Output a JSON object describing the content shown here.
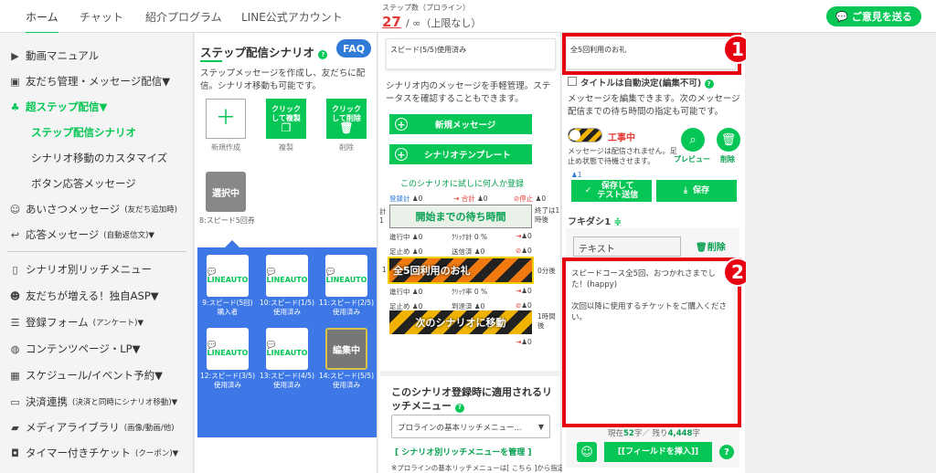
{
  "top_nav": {
    "tabs": [
      "ホーム",
      "チャット",
      "紹介プログラム",
      "LINE公式アカウント"
    ],
    "step_label": "ステップ数（プロライン）",
    "step_value": "27",
    "step_rest": "/ ∞（上限なし）",
    "feedback": "ご意見を送る"
  },
  "sidebar": {
    "items": [
      {
        "icon": "video-icon",
        "label": "動画マニュアル"
      },
      {
        "icon": "contacts-icon",
        "label": "友だち管理・メッセージ配信▼"
      },
      {
        "icon": "step-icon",
        "label": "超ステップ配信▼"
      },
      {
        "icon": "chat-icon",
        "label": "あいさつメッセージ",
        "small": "(友だち追加時)"
      },
      {
        "icon": "reply-icon",
        "label": "応答メッセージ",
        "small": "(自動返信文)▼"
      },
      {
        "icon": "phone-icon",
        "label": "シナリオ別リッチメニュー"
      },
      {
        "icon": "friends-icon",
        "label": "友だちが増える！独自ASP▼"
      },
      {
        "icon": "list-icon",
        "label": "登録フォーム",
        "small": "(アンケート)▼"
      },
      {
        "icon": "globe-icon",
        "label": "コンテンツページ・LP▼"
      },
      {
        "icon": "calendar-icon",
        "label": "スケジュール/イベント予約▼"
      },
      {
        "icon": "card-icon",
        "label": "決済連携",
        "small": "(決済と同時にシナリオ移動)▼"
      },
      {
        "icon": "folder-icon",
        "label": "メディアライブラリ",
        "small": "(画像/動画/他)"
      },
      {
        "icon": "ticket-icon",
        "label": "タイマー付きチケット",
        "small": "(クーポン)▼"
      }
    ],
    "sub_items": [
      "ステップ配信シナリオ",
      "シナリオ移動のカスタマイズ",
      "ボタン応答メッセージ"
    ]
  },
  "scenario_panel": {
    "title": "ステップ配信シナリオ",
    "faq": "FAQ",
    "description": "ステップメッセージを作成し、友だちに配信。シナリオ移動も可能です。",
    "tools": [
      {
        "label": "",
        "caption": "新規作成"
      },
      {
        "label": "クリック\nして複製",
        "caption": "複製"
      },
      {
        "label": "クリック\nして削除",
        "caption": "削除"
      }
    ],
    "selected_card": "選択中",
    "selected_caption": "8:スピード5回券",
    "cards": [
      {
        "caption": "9:スピード(5回)購入者"
      },
      {
        "caption": "10:スピード(1/5)使用済み"
      },
      {
        "caption": "11:スピード(2/5)使用済み"
      },
      {
        "caption": "12:スピード(3/5)使用済み"
      },
      {
        "caption": "13:スピード(4/5)使用済み"
      },
      {
        "caption": "14:スピード(5/5)使用済み",
        "overlay": "編集中"
      }
    ],
    "card_logo": "LINEAUTO"
  },
  "flow_panel": {
    "header": "スピード(5/5)使用済み",
    "description": "シナリオ内のメッセージを手軽管理。ステータスを確認することもできます。",
    "new_message": "新規メッセージ",
    "template": "シナリオテンプレート",
    "test_link": "このシナリオに試しに何人か登録",
    "stats_top": {
      "registered": "登録計",
      "r_val": "0",
      "total": "合計",
      "t_val": "0",
      "stop": "停止",
      "s_val": "0"
    },
    "start_label_left": "計1",
    "end_label": "終了は1時後",
    "wait_bar": "開始までの待ち時間",
    "row1": {
      "progress": "進行中",
      "p": "0",
      "click_total": "ｸﾘｯｸ計",
      "c": "0 %",
      "v": "0"
    },
    "row2": {
      "stop": "足止め",
      "s": "0",
      "sent": "送信済",
      "sv": "0",
      "v": "0"
    },
    "msg_bar": "全5回利用のお礼",
    "msg_prefix": "1",
    "msg_after": "0分後",
    "row3": {
      "progress": "進行中",
      "p": "0",
      "click_rate": "ｸﾘｯｸ率",
      "c": "0 %",
      "v": "0"
    },
    "row4": {
      "stop": "足止め",
      "s": "0",
      "arrive": "到達済",
      "a": "0",
      "v": "0"
    },
    "move_bar": "次のシナリオに移動",
    "move_after": "1時間後",
    "move_stat": "0",
    "rich": {
      "title": "このシナリオ登録時に適用されるリッチメニュー",
      "select": "プロラインの基本リッチメニュー...",
      "manage": "[ シナリオ別リッチメニューを管理 ]",
      "note": "※プロラインの基本リッチメニューは[ こちら ]から指定できます。"
    }
  },
  "editor_panel": {
    "title_value": "全5回利用のお礼",
    "badge1": "1",
    "badge2": "2",
    "auto_title": "タイトルは自動決定(編集不可)",
    "description": "メッセージを編集できます。次のメッセージ配信までの待ち時間の指定も可能です。",
    "status": "工事中",
    "status_note": "メッセージは配信されません。足止め状態で待機させます。",
    "preview": "プレビュー",
    "delete": "削除",
    "person_count": "1",
    "save_test": "保存して\nテスト送信",
    "save": "保存",
    "bubble_label": "フキダシ1",
    "input_type": "テキスト",
    "bubble_delete": "削除",
    "message": "スピードコース全5回、おつかれさまでした！(happy)\n\n次回以降に使用するチケットをご購入ください。",
    "count_label": "現在",
    "count_now": "52",
    "count_mid": "字／ 残り",
    "count_left": "4,448",
    "count_unit": "字",
    "insert_field": "[[フィールドを挿入]]"
  },
  "colors": {
    "accent": "#06c755",
    "blue": "#3d78e6",
    "highlight": "#e60012"
  }
}
